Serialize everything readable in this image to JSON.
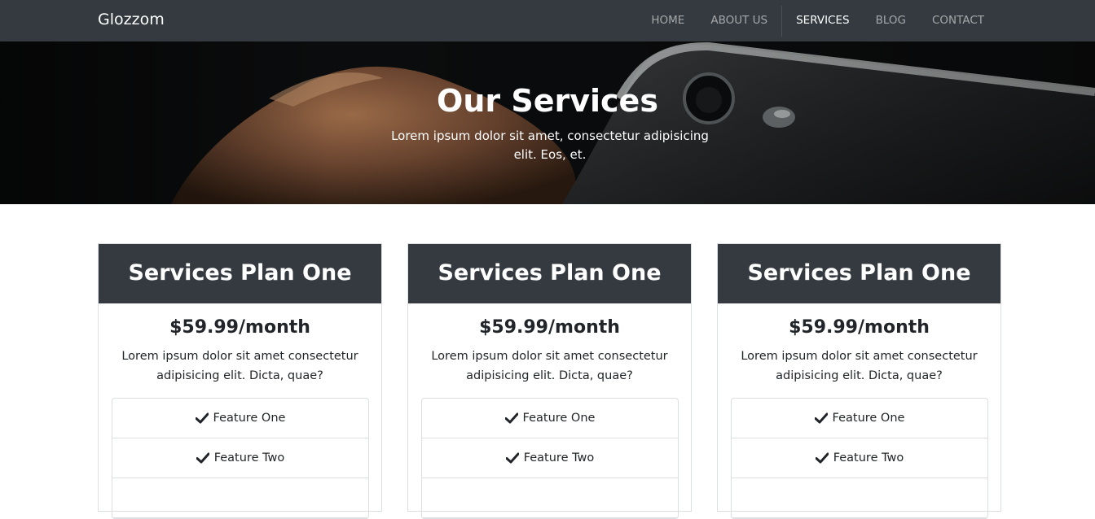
{
  "navbar": {
    "brand": "Glozzom",
    "items": [
      {
        "label": "HOME",
        "active": false
      },
      {
        "label": "ABOUT US",
        "active": false
      },
      {
        "label": "SERVICES",
        "active": true
      },
      {
        "label": "BLOG",
        "active": false
      },
      {
        "label": "CONTACT",
        "active": false
      }
    ]
  },
  "hero": {
    "title": "Our Services",
    "subtitle": "Lorem ipsum dolor sit amet, consectetur adipisicing elit. Eos, et."
  },
  "plans": [
    {
      "title": "Services Plan One",
      "price": "$59.99/month",
      "description": "Lorem ipsum dolor sit amet consectetur adipisicing elit. Dicta, quae?",
      "features": [
        "Feature One",
        "Feature Two"
      ]
    },
    {
      "title": "Services Plan One",
      "price": "$59.99/month",
      "description": "Lorem ipsum dolor sit amet consectetur adipisicing elit. Dicta, quae?",
      "features": [
        "Feature One",
        "Feature Two"
      ]
    },
    {
      "title": "Services Plan One",
      "price": "$59.99/month",
      "description": "Lorem ipsum dolor sit amet consectetur adipisicing elit. Dicta, quae?",
      "features": [
        "Feature One",
        "Feature Two"
      ]
    }
  ],
  "colors": {
    "navbar_bg": "#343a40",
    "card_header_bg": "#343a40",
    "text": "#212529"
  },
  "icons": {
    "feature_icon": "check-icon"
  }
}
